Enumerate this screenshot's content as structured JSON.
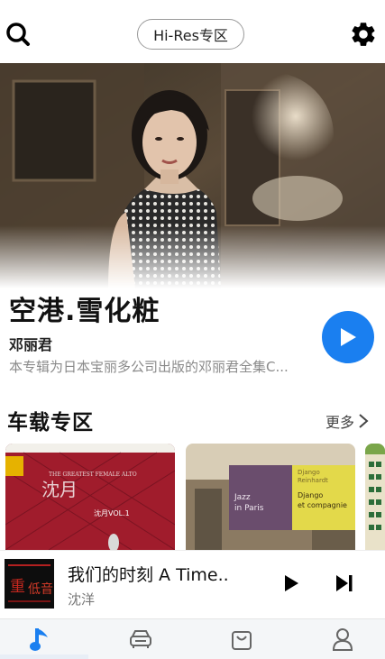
{
  "header": {
    "hires_label": "Hi-Res专区"
  },
  "featured": {
    "title": "空港.雪化粧",
    "artist": "邓丽君",
    "description": "本专辑为日本宝丽多公司出版的邓丽君全集C..."
  },
  "section": {
    "title": "车载专区",
    "more_label": "更多"
  },
  "cards": [
    {
      "name": "card-1",
      "cover_text": "THE GREATEST FEMALE ALTO",
      "cover_sub": "沈月VOL.1"
    },
    {
      "name": "card-2",
      "cover_text_1": "Jazz in Paris",
      "cover_text_2": "Django Reinhardt",
      "cover_text_3": "Django et compagnie"
    }
  ],
  "now_playing": {
    "title": "我们的时刻 A Time..",
    "artist": "沈洋"
  },
  "nav": {
    "items": [
      "music",
      "car",
      "shop",
      "profile"
    ],
    "active": "music"
  },
  "colors": {
    "accent": "#1a7ff0",
    "text_primary": "#111111",
    "text_secondary": "#8a8a8a"
  }
}
